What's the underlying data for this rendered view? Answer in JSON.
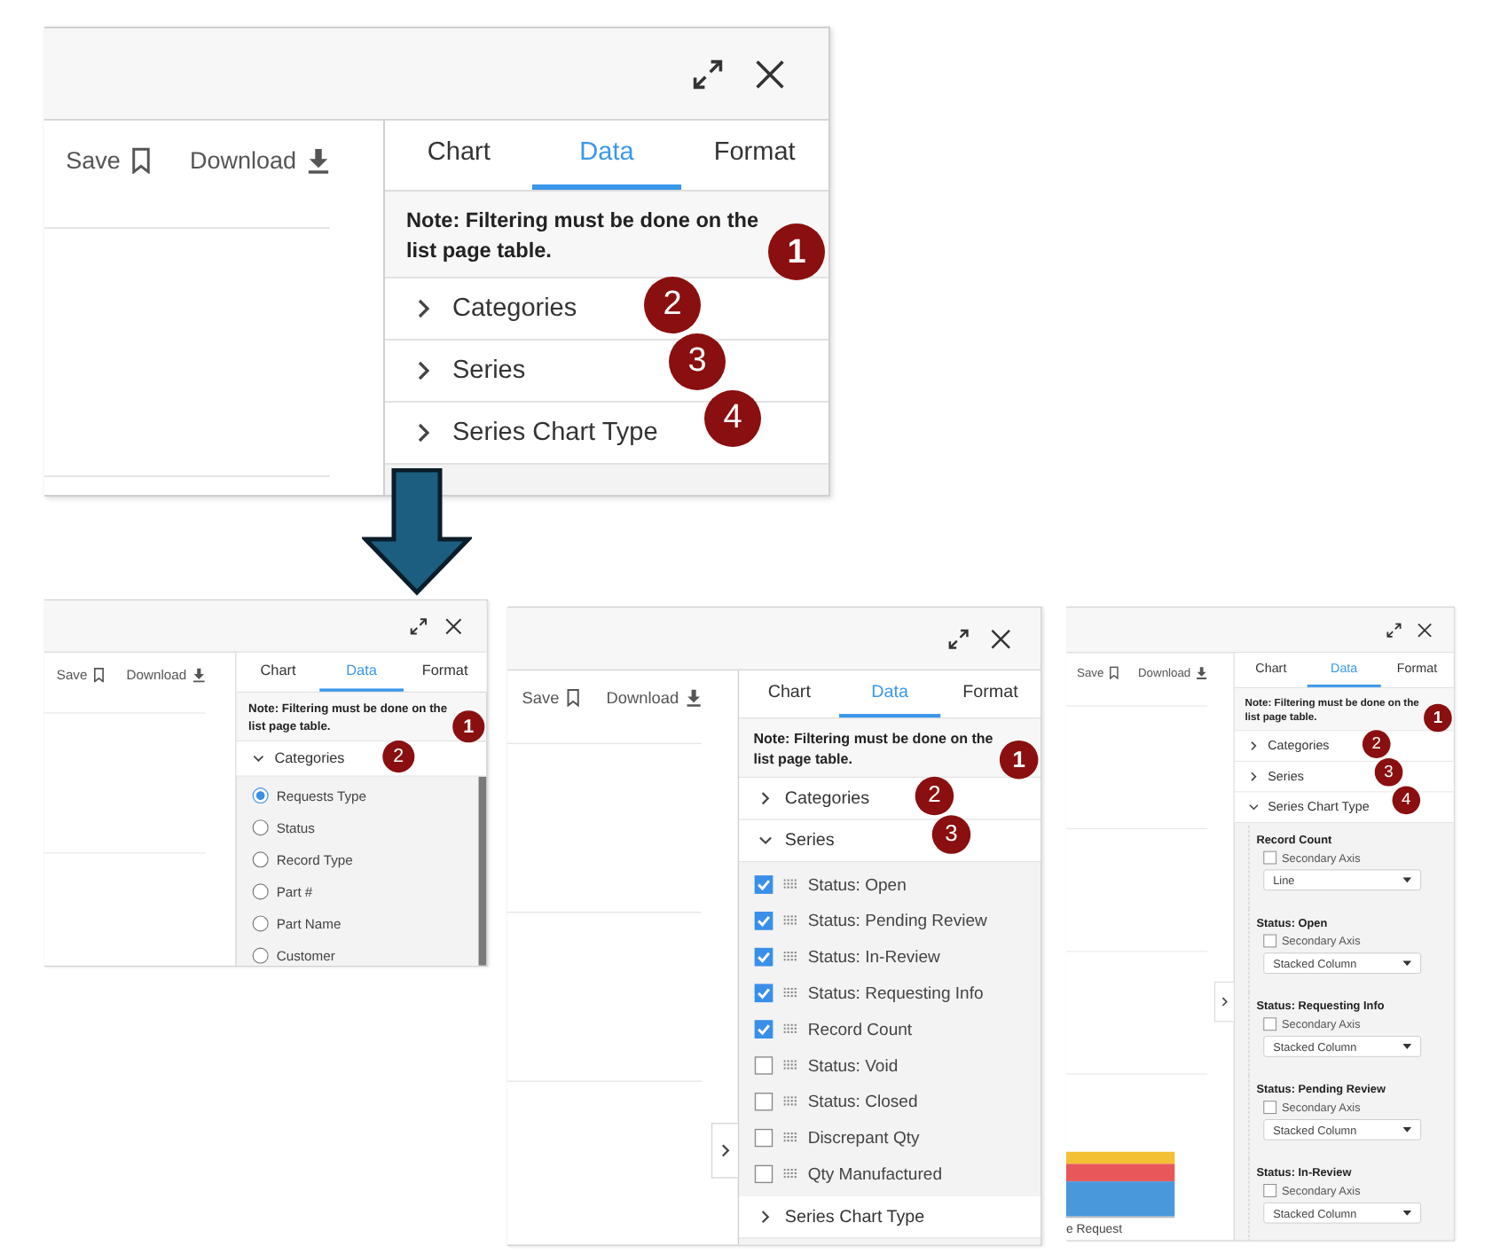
{
  "panels": [
    {
      "toolbar": {
        "save": "Save",
        "download": "Download"
      },
      "tabs": [
        {
          "label": "Chart",
          "selected": false
        },
        {
          "label": "Data",
          "selected": true
        },
        {
          "label": "Format",
          "selected": false
        }
      ],
      "note": "Note: Filtering must be done on the list page table.",
      "note_badge": "1",
      "sections": [
        {
          "title": "Categories",
          "expanded": false,
          "badge": "2"
        },
        {
          "title": "Series",
          "expanded": false,
          "badge": "3"
        },
        {
          "title": "Series Chart Type",
          "expanded": false,
          "badge": "4"
        }
      ],
      "side_toggle": false,
      "scrollbar": false
    },
    {
      "toolbar": {
        "save": "Save",
        "download": "Download"
      },
      "tabs": [
        {
          "label": "Chart",
          "selected": false
        },
        {
          "label": "Data",
          "selected": true
        },
        {
          "label": "Format",
          "selected": false
        }
      ],
      "note": "Note: Filtering must be done on the list page table.",
      "note_badge": "1",
      "sections": [
        {
          "title": "Categories",
          "expanded": true,
          "badge": "2",
          "options": [
            {
              "label": "Requests Type",
              "selected": true
            },
            {
              "label": "Status",
              "selected": false
            },
            {
              "label": "Record Type",
              "selected": false
            },
            {
              "label": "Part #",
              "selected": false
            },
            {
              "label": "Part Name",
              "selected": false
            },
            {
              "label": "Customer",
              "selected": false
            }
          ]
        }
      ],
      "side_toggle": false,
      "scrollbar": true
    },
    {
      "toolbar": {
        "save": "Save",
        "download": "Download"
      },
      "tabs": [
        {
          "label": "Chart",
          "selected": false
        },
        {
          "label": "Data",
          "selected": true
        },
        {
          "label": "Format",
          "selected": false
        }
      ],
      "note": "Note: Filtering must be done on the list page table.",
      "note_badge": "1",
      "sections": [
        {
          "title": "Categories",
          "expanded": false,
          "badge": "2"
        },
        {
          "title": "Series",
          "expanded": true,
          "badge": "3",
          "items": [
            {
              "label": "Status: Open",
              "checked": true
            },
            {
              "label": "Status: Pending Review",
              "checked": true
            },
            {
              "label": "Status: In-Review",
              "checked": true
            },
            {
              "label": "Status: Requesting Info",
              "checked": true
            },
            {
              "label": "Record Count",
              "checked": true
            },
            {
              "label": "Status: Void",
              "checked": false
            },
            {
              "label": "Status: Closed",
              "checked": false
            },
            {
              "label": "Discrepant Qty",
              "checked": false
            },
            {
              "label": "Qty Manufactured",
              "checked": false
            }
          ]
        },
        {
          "title": "Series Chart Type",
          "expanded": false
        }
      ],
      "side_toggle": true,
      "scrollbar": false
    },
    {
      "toolbar": {
        "save": "Save",
        "download": "Download"
      },
      "tabs": [
        {
          "label": "Chart",
          "selected": false
        },
        {
          "label": "Data",
          "selected": true
        },
        {
          "label": "Format",
          "selected": false
        }
      ],
      "note": "Note: Filtering must be done on the list page table.",
      "note_badge": "1",
      "sections": [
        {
          "title": "Categories",
          "expanded": false,
          "badge": "2"
        },
        {
          "title": "Series",
          "expanded": false,
          "badge": "3"
        },
        {
          "title": "Series Chart Type",
          "expanded": true,
          "badge": "4",
          "groups": [
            {
              "title": "Record Count",
              "secondary_axis": {
                "label": "Secondary Axis",
                "checked": false
              },
              "chart_type": "Line"
            },
            {
              "title": "Status: Open",
              "secondary_axis": {
                "label": "Secondary Axis",
                "checked": false
              },
              "chart_type": "Stacked Column"
            },
            {
              "title": "Status: Requesting Info",
              "secondary_axis": {
                "label": "Secondary Axis",
                "checked": false
              },
              "chart_type": "Stacked Column"
            },
            {
              "title": "Status: Pending Review",
              "secondary_axis": {
                "label": "Secondary Axis",
                "checked": false
              },
              "chart_type": "Stacked Column"
            },
            {
              "title": "Status: In-Review",
              "secondary_axis": {
                "label": "Secondary Axis",
                "checked": false
              },
              "chart_type": "Stacked Column"
            }
          ]
        }
      ],
      "side_toggle": true,
      "scrollbar": false,
      "chart": {
        "axis_label": "e Request"
      }
    }
  ]
}
